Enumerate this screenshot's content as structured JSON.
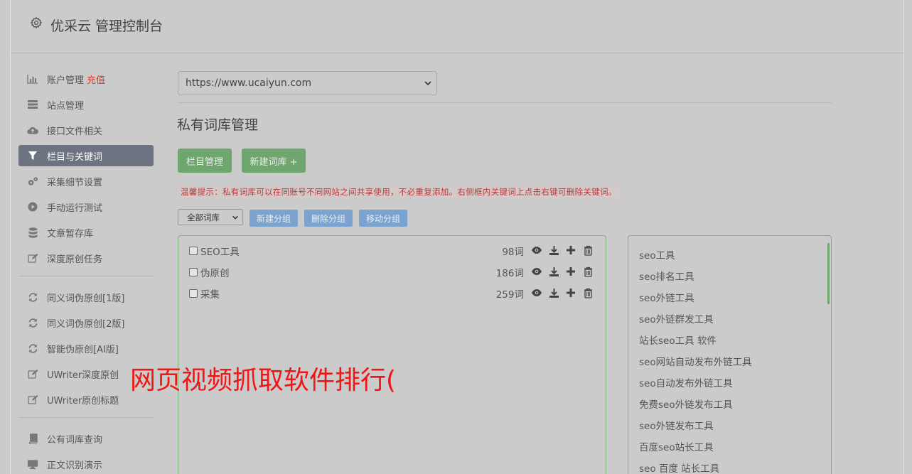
{
  "header": {
    "title": "优采云 管理控制台",
    "icon": "gear-icon"
  },
  "sidebar": {
    "group1": [
      {
        "label": "账户管理",
        "extra": "充值",
        "icon": "bar-chart-icon"
      },
      {
        "label": "站点管理",
        "icon": "server-icon"
      },
      {
        "label": "接口文件相关",
        "icon": "cloud-upload-icon"
      },
      {
        "label": "栏目与关键词",
        "icon": "filter-icon",
        "active": true
      },
      {
        "label": "采集细节设置",
        "icon": "cogs-icon"
      },
      {
        "label": "手动运行测试",
        "icon": "play-circle-icon"
      },
      {
        "label": "文章暂存库",
        "icon": "database-icon"
      },
      {
        "label": "深度原创任务",
        "icon": "edit-icon"
      }
    ],
    "group2": [
      {
        "label": "同义词伪原创[1版]",
        "icon": "refresh-icon"
      },
      {
        "label": "同义词伪原创[2版]",
        "icon": "refresh-icon"
      },
      {
        "label": "智能伪原创[AI版]",
        "icon": "refresh-icon"
      },
      {
        "label": "UWriter深度原创",
        "icon": "edit-icon"
      },
      {
        "label": "UWriter原创标题",
        "icon": "edit-icon"
      }
    ],
    "group3": [
      {
        "label": "公有词库查询",
        "icon": "book-icon"
      },
      {
        "label": "正文识别演示",
        "icon": "monitor-icon"
      }
    ]
  },
  "main": {
    "site_select": "https://www.ucaiyun.com",
    "title": "私有词库管理",
    "btn_columns": "栏目管理",
    "btn_new_lib": "新建词库 +",
    "tip": "温馨提示：私有词库可以在同账号不同网站之间共享使用，不必重复添加。右侧框内关键词上点击右键可删除关键词。",
    "group_select": "全部词库",
    "btn_new_group": "新建分组",
    "btn_delete_group": "删除分组",
    "btn_move_group": "移动分组",
    "libraries": [
      {
        "name": "SEO工具",
        "count": "98词"
      },
      {
        "name": "伪原创",
        "count": "186词"
      },
      {
        "name": "采集",
        "count": "259词"
      }
    ],
    "keywords": [
      "seo工具",
      "seo排名工具",
      "seo外链工具",
      "seo外链群发工具",
      "站长seo工具 软件",
      "seo网站自动发布外链工具",
      "seo自动发布外链工具",
      "免费seo外链发布工具",
      "seo外链发布工具",
      "百度seo站长工具",
      "seo 百度 站长工具"
    ]
  },
  "overlay_text": "网页视频抓取软件排行(",
  "colors": {
    "active_nav": "#6d7380",
    "green_btn": "#6ea66e",
    "blue_btn": "#7ba3cf",
    "tip_red": "#b53b3b",
    "overlay_red": "#f21515"
  }
}
